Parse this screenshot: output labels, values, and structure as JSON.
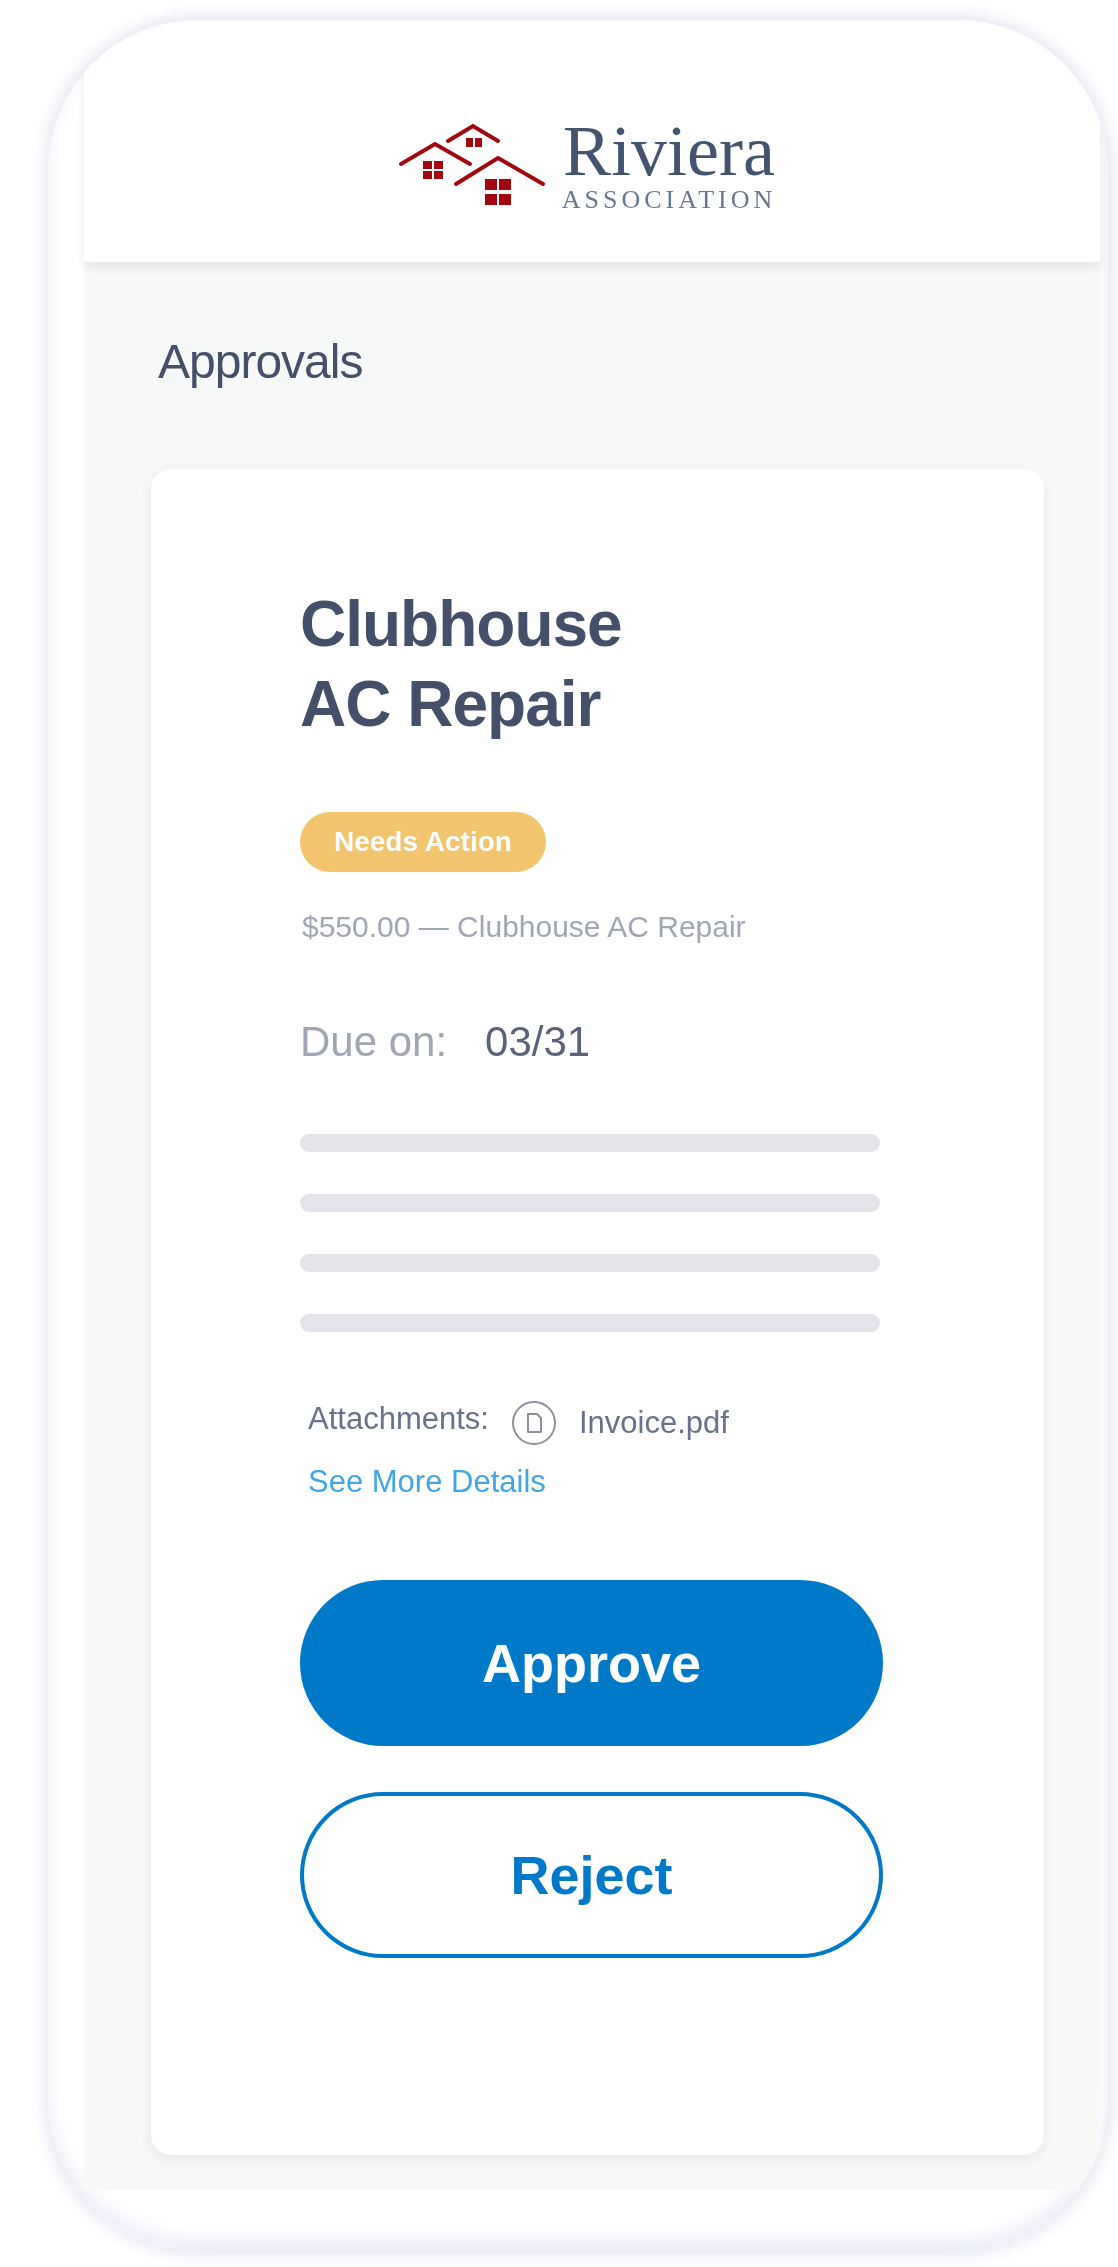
{
  "header": {
    "logo": {
      "name": "Riviera",
      "tagline": "ASSOCIATION"
    }
  },
  "page_title": "Approvals",
  "card": {
    "title": "Clubhouse AC Repair",
    "status": {
      "label": "Needs Action",
      "kind": "warning"
    },
    "summary": "$550.00 — Clubhouse AC Repair",
    "due_label": "Due on:",
    "due_date": "03/31",
    "attachments_label": "Attachments:",
    "attachment": "Invoice.pdf",
    "details_link": "See More Details",
    "buttons": [
      {
        "label": "Approve",
        "kind": "primary"
      },
      {
        "label": "Reject",
        "kind": "secondary"
      }
    ]
  }
}
